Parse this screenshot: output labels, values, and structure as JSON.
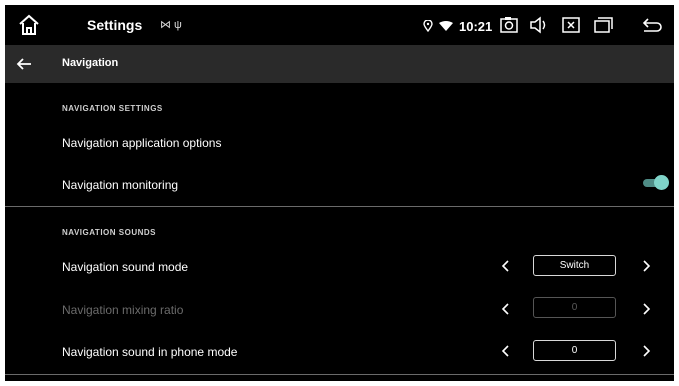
{
  "status_bar": {
    "title": "Settings",
    "small_icons": "⋈ ψ",
    "time": "10:21",
    "icons": [
      "home-icon",
      "location-icon",
      "wifi-icon",
      "camera-icon",
      "volume-icon",
      "close-box-icon",
      "windows-icon",
      "return-icon"
    ]
  },
  "app_bar": {
    "title": "Navigation"
  },
  "sections": {
    "nav_settings": {
      "header": "NAVIGATION SETTINGS",
      "app_options": "Navigation application options",
      "monitoring": "Navigation monitoring",
      "monitoring_on": true
    },
    "nav_sounds": {
      "header": "NAVIGATION SOUNDS",
      "sound_mode": {
        "label": "Navigation sound mode",
        "value": "Switch"
      },
      "mixing_ratio": {
        "label": "Navigation mixing ratio",
        "value": "0",
        "enabled": false
      },
      "phone_mode": {
        "label": "Navigation sound in phone mode",
        "value": "0"
      }
    }
  },
  "colors": {
    "background": "#000000",
    "appbar": "#2a2a2a",
    "toggle_accent": "#7fd3c8"
  }
}
